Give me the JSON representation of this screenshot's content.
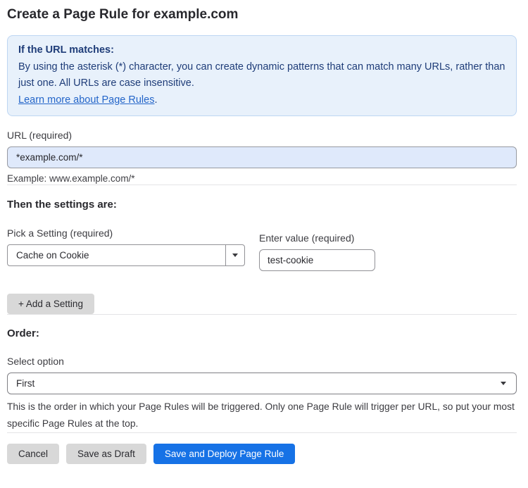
{
  "page": {
    "title": "Create a Page Rule for example.com"
  },
  "info_box": {
    "heading": "If the URL matches:",
    "body": "By using the asterisk (*) character, you can create dynamic patterns that can match many URLs, rather than just one. All URLs are case insensitive.",
    "link_label": "Learn more about Page Rules",
    "link_suffix": "."
  },
  "url_field": {
    "label": "URL (required)",
    "value": "*example.com/*",
    "example": "Example: www.example.com/*"
  },
  "settings": {
    "heading": "Then the settings are:",
    "setting_label": "Pick a Setting (required)",
    "setting_value": "Cache on Cookie",
    "value_label": "Enter value (required)",
    "value_value": "test-cookie",
    "add_button_label": "+ Add a Setting"
  },
  "order": {
    "heading": "Order:",
    "select_label": "Select option",
    "select_value": "First",
    "help": "This is the order in which your Page Rules will be triggered. Only one Page Rule will trigger per URL, so put your most specific Page Rules at the top."
  },
  "actions": {
    "cancel_label": "Cancel",
    "save_draft_label": "Save as Draft",
    "save_deploy_label": "Save and Deploy Page Rule"
  },
  "icons": {
    "setting_dropdown_icon": "chevron-down",
    "order_select_icon": "chevron-down"
  },
  "colors": {
    "info_box_bg": "#e8f1fb",
    "info_box_border": "#bdd6f2",
    "info_box_text": "#1e3c78",
    "link": "#2365c9",
    "url_input_bg": "#dfe9fb",
    "gray_button_bg": "#d8d8d8",
    "primary_button_bg": "#1672e6",
    "divider": "#e4e4e6"
  }
}
